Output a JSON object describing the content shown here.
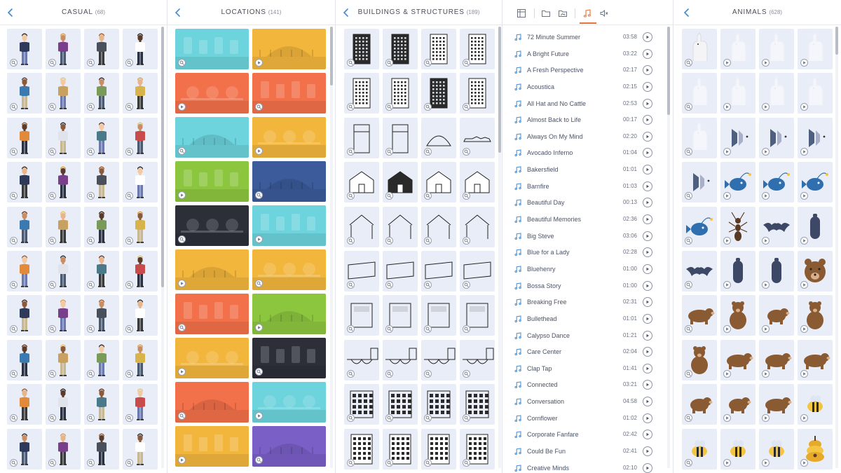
{
  "panels": {
    "casual": {
      "title": "CASUAL",
      "count": "(68)"
    },
    "locations": {
      "title": "LOCATIONS",
      "count": "(141)"
    },
    "buildings": {
      "title": "BUILDINGS & STRUCTURES",
      "count": "(189)"
    },
    "animals": {
      "title": "ANIMALS",
      "count": "(628)"
    }
  },
  "icons": {
    "back": "chevron-left-icon",
    "zoom": "zoom-icon",
    "play": "play-icon",
    "note": "music-note-icon",
    "tabs": [
      "layout-icon",
      "folder-icon",
      "image-folder-icon",
      "music-note-icon",
      "sound-effects-icon"
    ]
  },
  "colors": {
    "accent": "#e8733a",
    "tile_bg": "#e9edf7",
    "icon_blue": "#3d8bd4",
    "brown": "#8a5a33",
    "location_palette": [
      "#6dd3dc",
      "#f2b63c",
      "#f2704a",
      "#8cc63f",
      "#3b5b9a",
      "#2c2f38",
      "#7a5fc7"
    ]
  },
  "casual": {
    "rows": 10,
    "cols": 4,
    "badge_play_rows": []
  },
  "locations": {
    "tiles": [
      [
        "teal",
        "yellow"
      ],
      [
        "orange",
        "orange"
      ],
      [
        "teal",
        "yellow"
      ],
      [
        "green",
        "navy"
      ],
      [
        "dark",
        "teal"
      ],
      [
        "yellow",
        "yellow"
      ],
      [
        "orange",
        "green"
      ],
      [
        "yellow",
        "dark"
      ],
      [
        "orange",
        "teal"
      ],
      [
        "yellow",
        "purple"
      ]
    ]
  },
  "buildings": {
    "rows": 10,
    "cols": 4
  },
  "animals": {
    "grid": [
      [
        "llama",
        "llama-faded",
        "llama-faded",
        "llama-faded"
      ],
      [
        "llama-faded",
        "llama-faded",
        "llama-faded",
        "llama-faded"
      ],
      [
        "llama-faded",
        "fish-fin",
        "fish-fin",
        "fish-fin"
      ],
      [
        "fish-fin",
        "anglerfish",
        "anglerfish",
        "anglerfish"
      ],
      [
        "anglerfish",
        "ant",
        "bat",
        "cocoon"
      ],
      [
        "bat",
        "cocoon",
        "cocoon",
        "bear-face"
      ],
      [
        "bear",
        "bear-front",
        "bear-small",
        "bear-stand"
      ],
      [
        "bear-sit",
        "bear-walk",
        "bear-walk",
        "bear-walk"
      ],
      [
        "bear-small",
        "bear-small",
        "bear-walk",
        "bee"
      ],
      [
        "bee",
        "bee",
        "bee",
        "beehive"
      ]
    ]
  },
  "music": {
    "tracks": [
      {
        "title": "72 Minute Summer",
        "duration": "03:58"
      },
      {
        "title": "A Bright Future",
        "duration": "03:22"
      },
      {
        "title": "A Fresh Perspective",
        "duration": "02:17"
      },
      {
        "title": "Acoustica",
        "duration": "02:15"
      },
      {
        "title": "All Hat and No Cattle",
        "duration": "02:53"
      },
      {
        "title": "Almost Back to Life",
        "duration": "00:17"
      },
      {
        "title": "Always On My Mind",
        "duration": "02:20"
      },
      {
        "title": "Avocado Inferno",
        "duration": "01:04"
      },
      {
        "title": "Bakersfield",
        "duration": "01:01"
      },
      {
        "title": "Barnfire",
        "duration": "01:03"
      },
      {
        "title": "Beautiful Day",
        "duration": "00:13"
      },
      {
        "title": "Beautiful Memories",
        "duration": "02:36"
      },
      {
        "title": "Big Steve",
        "duration": "03:06"
      },
      {
        "title": "Blue for a Lady",
        "duration": "02:28"
      },
      {
        "title": "Bluehenry",
        "duration": "01:00"
      },
      {
        "title": "Bossa Story",
        "duration": "01:00"
      },
      {
        "title": "Breaking Free",
        "duration": "02:31"
      },
      {
        "title": "Bullethead",
        "duration": "01:01"
      },
      {
        "title": "Calypso Dance",
        "duration": "01:21"
      },
      {
        "title": "Care Center",
        "duration": "02:04"
      },
      {
        "title": "Clap Tap",
        "duration": "01:41"
      },
      {
        "title": "Connected",
        "duration": "03:21"
      },
      {
        "title": "Conversation",
        "duration": "04:58"
      },
      {
        "title": "Cornflower",
        "duration": "01:02"
      },
      {
        "title": "Corporate Fanfare",
        "duration": "02:42"
      },
      {
        "title": "Could Be Fun",
        "duration": "02:41"
      },
      {
        "title": "Creative Minds",
        "duration": "02:10"
      }
    ]
  }
}
